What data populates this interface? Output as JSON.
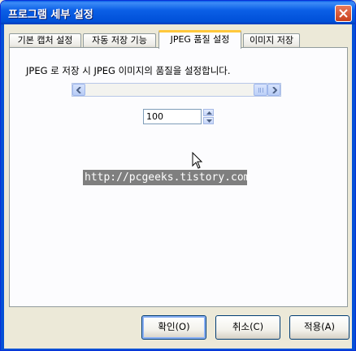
{
  "window": {
    "title": "프로그램 세부 설정"
  },
  "tabs": [
    {
      "label": "기본 캡처 설정"
    },
    {
      "label": "자동 저장 기능"
    },
    {
      "label": "JPEG 품질 설정"
    },
    {
      "label": "이미지 저장"
    }
  ],
  "active_tab_index": 2,
  "jpeg_panel": {
    "description": "JPEG 로 저장 시 JPEG 이미지의 품질을 설정합니다.",
    "quality_value": "100",
    "slider_level_percent": 100
  },
  "watermark": "http://pcgeeks.tistory.com",
  "buttons": {
    "ok": "확인(O)",
    "cancel": "취소(C)",
    "apply": "적용(A)"
  },
  "colors": {
    "titlebar": "#0a5fe8",
    "active_tab_accent": "#ffc83c",
    "panel_bg": "#fcfcfe",
    "dialog_bg": "#ece9d8"
  },
  "icons": {
    "close": "close-icon",
    "scroll_left": "arrow-left-icon",
    "scroll_right": "arrow-right-icon",
    "spin_up": "chevron-up-icon",
    "spin_down": "chevron-down-icon",
    "cursor": "mouse-pointer-icon"
  }
}
